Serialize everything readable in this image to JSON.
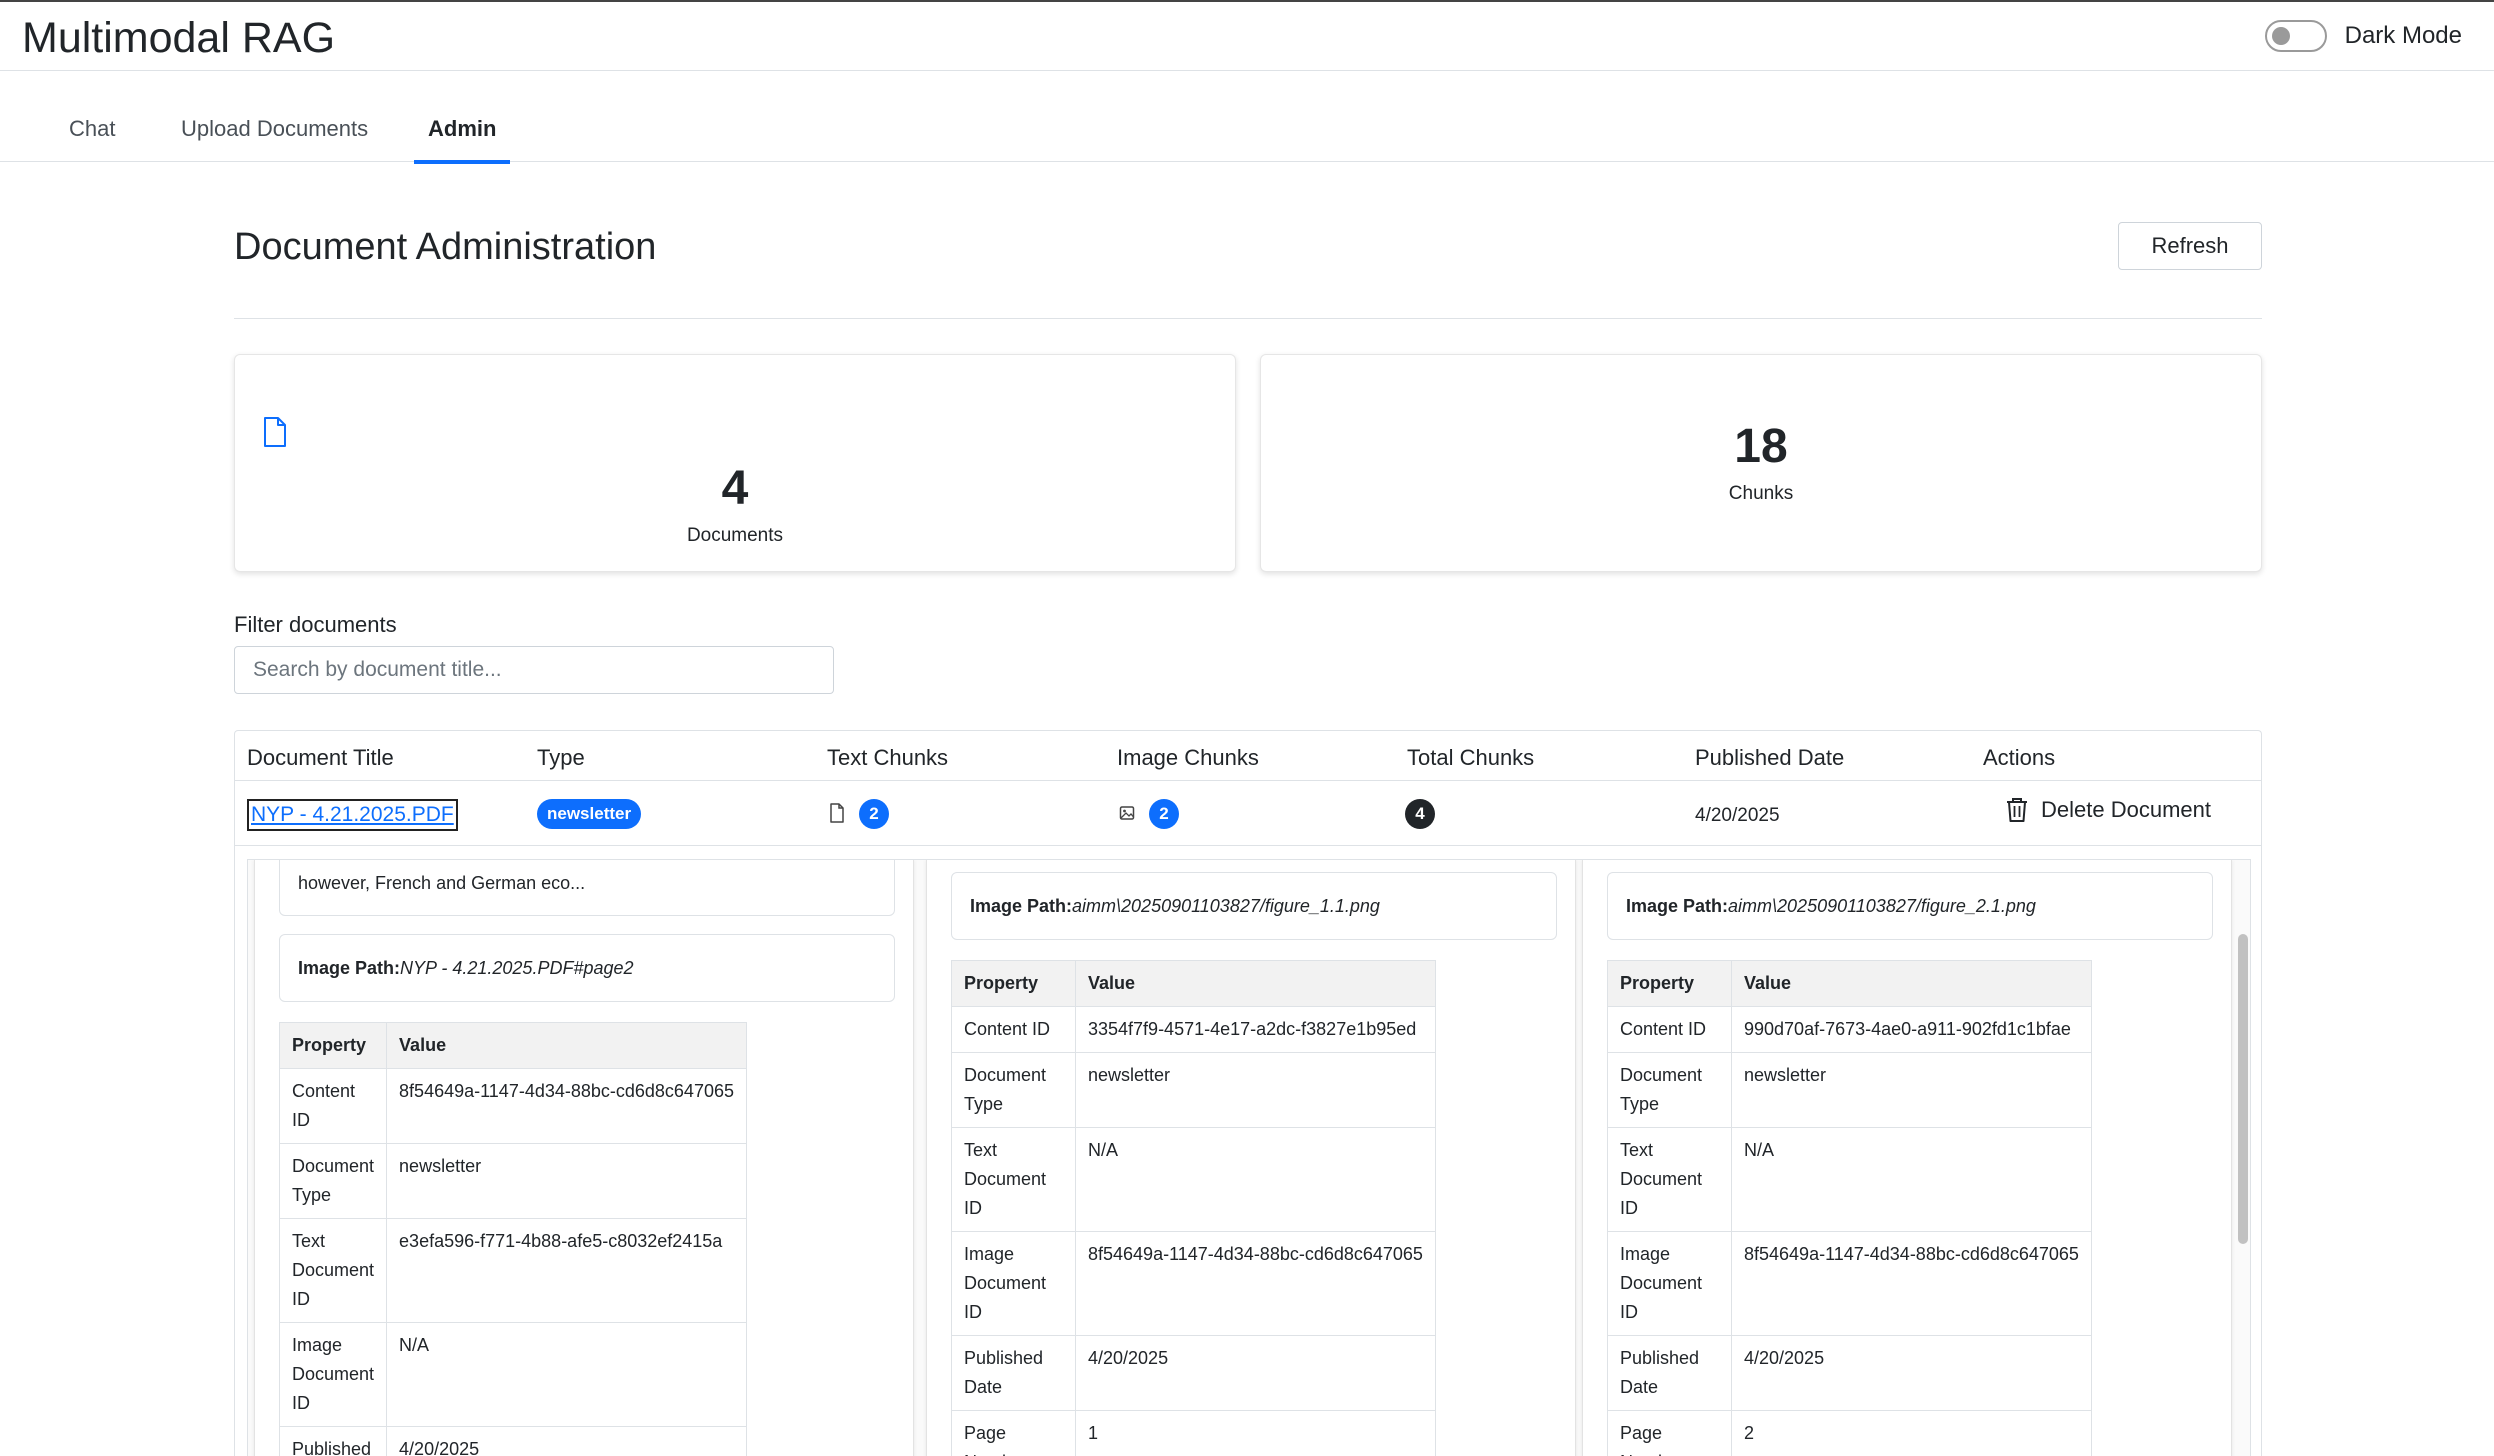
{
  "app": {
    "title": "Multimodal RAG",
    "dark_mode_label": "Dark Mode"
  },
  "tabs": [
    {
      "label": "Chat"
    },
    {
      "label": "Upload Documents"
    },
    {
      "label": "Admin"
    }
  ],
  "header": {
    "title": "Document Administration",
    "refresh_label": "Refresh"
  },
  "stats": {
    "documents": {
      "value": "4",
      "label": "Documents"
    },
    "chunks": {
      "value": "18",
      "label": "Chunks"
    }
  },
  "filter": {
    "label": "Filter documents",
    "placeholder": "Search by document title..."
  },
  "table": {
    "headers": [
      "Document Title",
      "Type",
      "Text Chunks",
      "Image Chunks",
      "Total Chunks",
      "Published Date",
      "Actions"
    ],
    "rows": [
      {
        "title": "NYP - 4.21.2025.PDF",
        "type": "newsletter",
        "text_chunks": "2",
        "image_chunks": "2",
        "total_chunks": "4",
        "published": "4/20/2025",
        "action": "Delete Document"
      }
    ]
  },
  "details": {
    "prop_header": "Property",
    "value_header": "Value",
    "path_label": "Image Path:",
    "col1": {
      "truncated_text": "however, French and German eco...",
      "path": "NYP - 4.21.2025.PDF#page2",
      "rows": [
        {
          "p": "Content ID",
          "v": "8f54649a-1147-4d34-88bc-cd6d8c647065"
        },
        {
          "p": "Document Type",
          "v": "newsletter"
        },
        {
          "p": "Text Document ID",
          "v": "e3efa596-f771-4b88-afe5-c8032ef2415a"
        },
        {
          "p": "Image Document ID",
          "v": "N/A"
        },
        {
          "p": "Published",
          "v": "4/20/2025"
        }
      ]
    },
    "col2": {
      "path": "aimm\\20250901103827/figure_1.1.png",
      "rows": [
        {
          "p": "Content ID",
          "v": "3354f7f9-4571-4e17-a2dc-f3827e1b95ed"
        },
        {
          "p": "Document Type",
          "v": "newsletter"
        },
        {
          "p": "Text Document ID",
          "v": "N/A"
        },
        {
          "p": "Image Document ID",
          "v": "8f54649a-1147-4d34-88bc-cd6d8c647065"
        },
        {
          "p": "Published Date",
          "v": "4/20/2025"
        },
        {
          "p": "Page Number",
          "v": "1"
        }
      ]
    },
    "col3": {
      "path": "aimm\\20250901103827/figure_2.1.png",
      "rows": [
        {
          "p": "Content ID",
          "v": "990d70af-7673-4ae0-a911-902fd1c1bfae"
        },
        {
          "p": "Document Type",
          "v": "newsletter"
        },
        {
          "p": "Text Document ID",
          "v": "N/A"
        },
        {
          "p": "Image Document ID",
          "v": "8f54649a-1147-4d34-88bc-cd6d8c647065"
        },
        {
          "p": "Published Date",
          "v": "4/20/2025"
        },
        {
          "p": "Page Number",
          "v": "2"
        }
      ]
    }
  }
}
